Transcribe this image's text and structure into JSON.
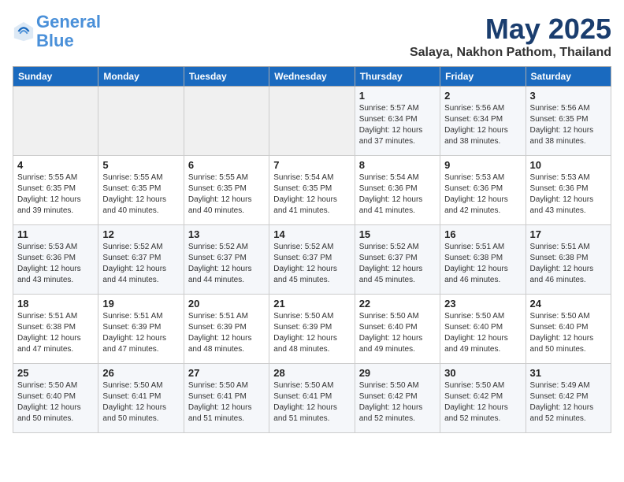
{
  "logo": {
    "line1": "General",
    "line2": "Blue"
  },
  "title": "May 2025",
  "subtitle": "Salaya, Nakhon Pathom, Thailand",
  "days_of_week": [
    "Sunday",
    "Monday",
    "Tuesday",
    "Wednesday",
    "Thursday",
    "Friday",
    "Saturday"
  ],
  "weeks": [
    [
      {
        "day": "",
        "info": ""
      },
      {
        "day": "",
        "info": ""
      },
      {
        "day": "",
        "info": ""
      },
      {
        "day": "",
        "info": ""
      },
      {
        "day": "1",
        "info": "Sunrise: 5:57 AM\nSunset: 6:34 PM\nDaylight: 12 hours\nand 37 minutes."
      },
      {
        "day": "2",
        "info": "Sunrise: 5:56 AM\nSunset: 6:34 PM\nDaylight: 12 hours\nand 38 minutes."
      },
      {
        "day": "3",
        "info": "Sunrise: 5:56 AM\nSunset: 6:35 PM\nDaylight: 12 hours\nand 38 minutes."
      }
    ],
    [
      {
        "day": "4",
        "info": "Sunrise: 5:55 AM\nSunset: 6:35 PM\nDaylight: 12 hours\nand 39 minutes."
      },
      {
        "day": "5",
        "info": "Sunrise: 5:55 AM\nSunset: 6:35 PM\nDaylight: 12 hours\nand 40 minutes."
      },
      {
        "day": "6",
        "info": "Sunrise: 5:55 AM\nSunset: 6:35 PM\nDaylight: 12 hours\nand 40 minutes."
      },
      {
        "day": "7",
        "info": "Sunrise: 5:54 AM\nSunset: 6:35 PM\nDaylight: 12 hours\nand 41 minutes."
      },
      {
        "day": "8",
        "info": "Sunrise: 5:54 AM\nSunset: 6:36 PM\nDaylight: 12 hours\nand 41 minutes."
      },
      {
        "day": "9",
        "info": "Sunrise: 5:53 AM\nSunset: 6:36 PM\nDaylight: 12 hours\nand 42 minutes."
      },
      {
        "day": "10",
        "info": "Sunrise: 5:53 AM\nSunset: 6:36 PM\nDaylight: 12 hours\nand 43 minutes."
      }
    ],
    [
      {
        "day": "11",
        "info": "Sunrise: 5:53 AM\nSunset: 6:36 PM\nDaylight: 12 hours\nand 43 minutes."
      },
      {
        "day": "12",
        "info": "Sunrise: 5:52 AM\nSunset: 6:37 PM\nDaylight: 12 hours\nand 44 minutes."
      },
      {
        "day": "13",
        "info": "Sunrise: 5:52 AM\nSunset: 6:37 PM\nDaylight: 12 hours\nand 44 minutes."
      },
      {
        "day": "14",
        "info": "Sunrise: 5:52 AM\nSunset: 6:37 PM\nDaylight: 12 hours\nand 45 minutes."
      },
      {
        "day": "15",
        "info": "Sunrise: 5:52 AM\nSunset: 6:37 PM\nDaylight: 12 hours\nand 45 minutes."
      },
      {
        "day": "16",
        "info": "Sunrise: 5:51 AM\nSunset: 6:38 PM\nDaylight: 12 hours\nand 46 minutes."
      },
      {
        "day": "17",
        "info": "Sunrise: 5:51 AM\nSunset: 6:38 PM\nDaylight: 12 hours\nand 46 minutes."
      }
    ],
    [
      {
        "day": "18",
        "info": "Sunrise: 5:51 AM\nSunset: 6:38 PM\nDaylight: 12 hours\nand 47 minutes."
      },
      {
        "day": "19",
        "info": "Sunrise: 5:51 AM\nSunset: 6:39 PM\nDaylight: 12 hours\nand 47 minutes."
      },
      {
        "day": "20",
        "info": "Sunrise: 5:51 AM\nSunset: 6:39 PM\nDaylight: 12 hours\nand 48 minutes."
      },
      {
        "day": "21",
        "info": "Sunrise: 5:50 AM\nSunset: 6:39 PM\nDaylight: 12 hours\nand 48 minutes."
      },
      {
        "day": "22",
        "info": "Sunrise: 5:50 AM\nSunset: 6:40 PM\nDaylight: 12 hours\nand 49 minutes."
      },
      {
        "day": "23",
        "info": "Sunrise: 5:50 AM\nSunset: 6:40 PM\nDaylight: 12 hours\nand 49 minutes."
      },
      {
        "day": "24",
        "info": "Sunrise: 5:50 AM\nSunset: 6:40 PM\nDaylight: 12 hours\nand 50 minutes."
      }
    ],
    [
      {
        "day": "25",
        "info": "Sunrise: 5:50 AM\nSunset: 6:40 PM\nDaylight: 12 hours\nand 50 minutes."
      },
      {
        "day": "26",
        "info": "Sunrise: 5:50 AM\nSunset: 6:41 PM\nDaylight: 12 hours\nand 50 minutes."
      },
      {
        "day": "27",
        "info": "Sunrise: 5:50 AM\nSunset: 6:41 PM\nDaylight: 12 hours\nand 51 minutes."
      },
      {
        "day": "28",
        "info": "Sunrise: 5:50 AM\nSunset: 6:41 PM\nDaylight: 12 hours\nand 51 minutes."
      },
      {
        "day": "29",
        "info": "Sunrise: 5:50 AM\nSunset: 6:42 PM\nDaylight: 12 hours\nand 52 minutes."
      },
      {
        "day": "30",
        "info": "Sunrise: 5:50 AM\nSunset: 6:42 PM\nDaylight: 12 hours\nand 52 minutes."
      },
      {
        "day": "31",
        "info": "Sunrise: 5:49 AM\nSunset: 6:42 PM\nDaylight: 12 hours\nand 52 minutes."
      }
    ]
  ]
}
